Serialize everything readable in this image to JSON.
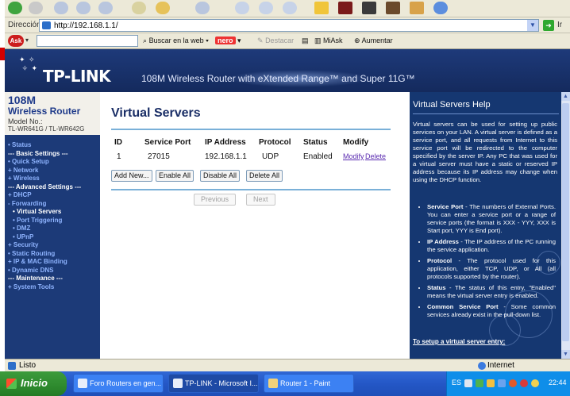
{
  "browser": {
    "address_label": "Dirección",
    "address_url": "http://192.168.1.1/",
    "go_label": "Ir",
    "toolbar": {
      "search_label": "Buscar en la web",
      "nero_label": "nero",
      "highlight_label": "Destacar",
      "miask_label": "MiAsk",
      "zoom_label": "Aumentar"
    },
    "status_text": "Listo",
    "zone_text": "Internet"
  },
  "banner": {
    "logo": "TP-LINK",
    "tagline": "108M Wireless Router with eXtended Range™ and Super 11G™"
  },
  "sidebar": {
    "head_108": "108M",
    "head_router": "Wireless Router",
    "model_label": "Model No.:",
    "model_value": "TL-WR641G / TL-WR642G",
    "items": [
      {
        "label": "• Status",
        "kind": "link"
      },
      {
        "label": "--- Basic Settings ---",
        "kind": "section"
      },
      {
        "label": "• Quick Setup",
        "kind": "link"
      },
      {
        "label": "+ Network",
        "kind": "link"
      },
      {
        "label": "+ Wireless",
        "kind": "link"
      },
      {
        "label": "--- Advanced Settings ---",
        "kind": "section"
      },
      {
        "label": "+ DHCP",
        "kind": "link"
      },
      {
        "label": "- Forwarding",
        "kind": "link"
      },
      {
        "label": "• Virtual Servers",
        "kind": "active"
      },
      {
        "label": "• Port Triggering",
        "kind": "sub"
      },
      {
        "label": "• DMZ",
        "kind": "sub"
      },
      {
        "label": "• UPnP",
        "kind": "sub"
      },
      {
        "label": "+ Security",
        "kind": "link"
      },
      {
        "label": "• Static Routing",
        "kind": "link"
      },
      {
        "label": "+ IP & MAC Binding",
        "kind": "link"
      },
      {
        "label": "• Dynamic DNS",
        "kind": "link"
      },
      {
        "label": "--- Maintenance ---",
        "kind": "section"
      },
      {
        "label": "+ System Tools",
        "kind": "link"
      }
    ]
  },
  "content": {
    "title": "Virtual Servers",
    "table": {
      "headers": [
        "ID",
        "Service Port",
        "IP Address",
        "Protocol",
        "Status",
        "Modify"
      ],
      "row": {
        "id": "1",
        "service_port": "27015",
        "ip_address": "192.168.1.1",
        "protocol": "UDP",
        "status": "Enabled",
        "modify_label": "Modify",
        "delete_label": "Delete"
      }
    },
    "buttons": {
      "add_new": "Add New...",
      "enable_all": "Enable All",
      "disable_all": "Disable All",
      "delete_all": "Delete All",
      "previous": "Previous",
      "next": "Next"
    }
  },
  "help": {
    "title": "Virtual Servers Help",
    "intro": "Virtual servers can be used for setting up public services on your LAN. A virtual server is defined as a service port, and all requests from Internet to this service port will be redirected to the computer specified by the server IP. Any PC that was used for a virtual server must have a static or reserved IP address because its IP address may change when using the DHCP function.",
    "items": [
      {
        "term": "Service Port",
        "text": " - The numbers of External Ports. You can enter a service port or a range of service ports (the format is XXX - YYY, XXX is Start port, YYY is End port)."
      },
      {
        "term": "IP Address",
        "text": " - The IP address of the PC running the service application."
      },
      {
        "term": "Protocol",
        "text": " - The protocol used for this application, either TCP, UDP, or All (all protocols supported by the router)."
      },
      {
        "term": "Status",
        "text": " - The status of this entry, \"Enabled\" means the virtual server entry is enabled."
      },
      {
        "term": "Common Service Port",
        "text": " - Some common services already exist in the pull-down list."
      }
    ],
    "footer": "To setup a virtual server entry:"
  },
  "taskbar": {
    "start_label": "Inicio",
    "tasks": [
      {
        "label": "Foro Routers en gen..."
      },
      {
        "label": "TP-LINK - Microsoft I..."
      },
      {
        "label": "Router 1 - Paint"
      }
    ],
    "tray_lang": "ES",
    "clock": "22:44"
  },
  "colors": {
    "nav_bg": "#1c3a78",
    "help_bg": "#153771",
    "title_color": "#1a2e66",
    "taskbar_blue": "#2457c6",
    "start_green": "#2e8a2e"
  }
}
